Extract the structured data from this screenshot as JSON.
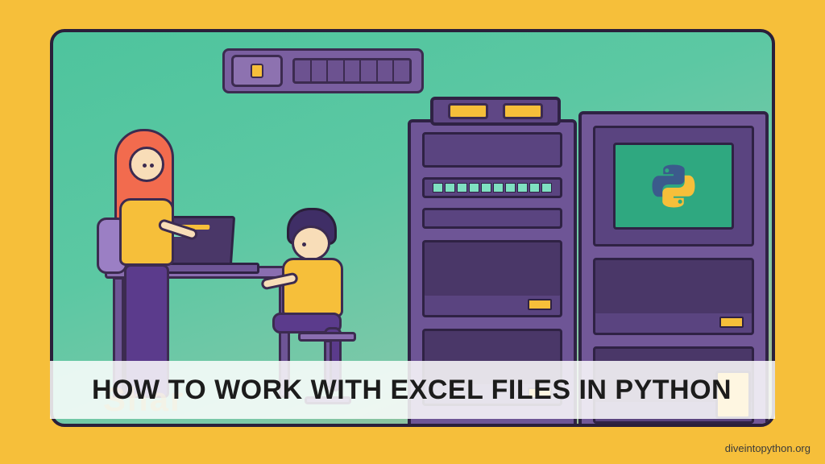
{
  "banner": {
    "title": "HOW TO WORK WITH EXCEL FILES IN PYTHON"
  },
  "credit": "diveintopython.org",
  "floor_text": "Shar",
  "icons": {
    "python_logo": "python-logo-icon"
  },
  "colors": {
    "bg": "#F6BF3A",
    "panel_gradient_start": "#4EC49D",
    "panel_gradient_end": "#B0B78C",
    "outline": "#2A1F3A",
    "purple_mid": "#6E5596",
    "purple_dark": "#4A3768",
    "accent_yellow": "#F6BF3A",
    "hair_red": "#F26B4E",
    "skin": "#F8DDB8"
  }
}
